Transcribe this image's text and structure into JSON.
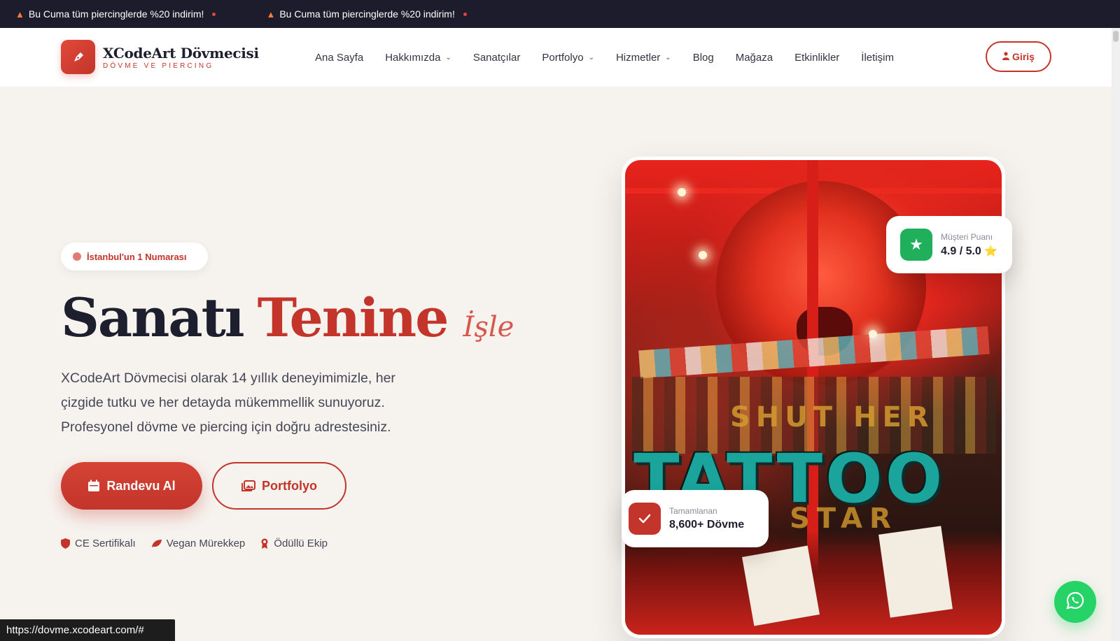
{
  "announcement": {
    "items": [
      "Bu Cuma tüm piercinglerde %20 indirim!",
      "Bu Cuma tüm piercinglerde %20 indirim!"
    ]
  },
  "brand": {
    "name": "XCodeArt Dövmecisi",
    "tagline": "DÖVME VE PIERCING"
  },
  "nav": {
    "items": [
      {
        "label": "Ana Sayfa",
        "dropdown": false
      },
      {
        "label": "Hakkımızda",
        "dropdown": true
      },
      {
        "label": "Sanatçılar",
        "dropdown": false
      },
      {
        "label": "Portfolyo",
        "dropdown": true
      },
      {
        "label": "Hizmetler",
        "dropdown": true
      },
      {
        "label": "Blog",
        "dropdown": false
      },
      {
        "label": "Mağaza",
        "dropdown": false
      },
      {
        "label": "Etkinlikler",
        "dropdown": false
      },
      {
        "label": "İletişim",
        "dropdown": false
      }
    ],
    "login_label": "Giriş"
  },
  "hero": {
    "badge": "İstanbul'un 1 Numarası",
    "title_dark": "Sanatı",
    "title_red": "Tenine",
    "title_script": "İşle",
    "description": "XCodeArt Dövmecisi olarak 14 yıllık deneyimimizle, her çizgide tutku ve her detayda mükemmellik sunuyoruz. Profesyonel dövme ve piercing için doğru adrestesiniz.",
    "cta_primary": "Randevu Al",
    "cta_secondary": "Portfolyo",
    "features": [
      {
        "label": "CE Sertifikalı",
        "icon": "shield-icon"
      },
      {
        "label": "Vegan Mürekkep",
        "icon": "leaf-icon"
      },
      {
        "label": "Ödüllü Ekip",
        "icon": "award-icon"
      }
    ]
  },
  "cards": {
    "rating": {
      "label": "Müşteri Puanı",
      "value": "4.9 / 5.0"
    },
    "completed": {
      "label": "Tamamlanan",
      "value": "8,600+ Dövme"
    }
  },
  "photo": {
    "sign_main": "TATTOO",
    "sign_top": "SHUT HER",
    "sign_bottom": "STAR"
  },
  "status_bar": {
    "url": "https://dovme.xcodeart.com/#"
  },
  "colors": {
    "accent": "#c3342a",
    "dark": "#1e1f2e",
    "topbar": "#1d1c2d",
    "whatsapp": "#25d366",
    "rating_green": "#20b05c"
  }
}
